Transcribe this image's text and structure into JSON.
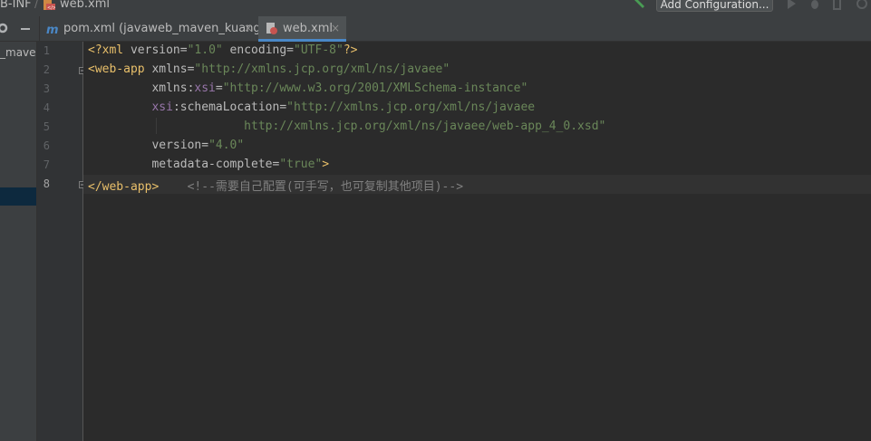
{
  "breadcrumb": {
    "parent": "B-INF",
    "separator": "/",
    "file": "web.xml"
  },
  "toolbar": {
    "run_config_label": "Add Configuration..."
  },
  "tabs": [
    {
      "label": "pom.xml (javaweb_maven_kuang)",
      "close": "×",
      "icon": "maven-m-icon",
      "active": false
    },
    {
      "label": "web.xml",
      "close": "×",
      "icon": "xml-file-icon",
      "active": true
    }
  ],
  "project_panel": {
    "item_label": "_maven"
  },
  "editor": {
    "line_numbers": [
      "1",
      "2",
      "3",
      "4",
      "5",
      "6",
      "7",
      "8"
    ],
    "current_line": "8",
    "lines": [
      {
        "parts": [
          [
            "tag",
            "<?xml "
          ],
          [
            "attr",
            "version="
          ],
          [
            "str",
            "\"1.0\""
          ],
          [
            "attr",
            " encoding="
          ],
          [
            "str",
            "\"UTF-8\""
          ],
          [
            "tag",
            "?>"
          ]
        ]
      },
      {
        "parts": [
          [
            "tag",
            "<web-app "
          ],
          [
            "attr",
            "xmlns="
          ],
          [
            "str",
            "\"http://xmlns.jcp.org/xml/ns/javaee\""
          ]
        ]
      },
      {
        "parts": [
          [
            "attr",
            "         xmlns:"
          ],
          [
            "ns",
            "xsi"
          ],
          [
            "attr",
            "="
          ],
          [
            "str",
            "\"http://www.w3.org/2001/XMLSchema-instance\""
          ]
        ]
      },
      {
        "parts": [
          [
            "attr",
            "         "
          ],
          [
            "ns",
            "xsi"
          ],
          [
            "attr",
            ":schemaLocation="
          ],
          [
            "str",
            "\"http://xmlns.jcp.org/xml/ns/javaee"
          ]
        ]
      },
      {
        "parts": [
          [
            "str",
            "                      http://xmlns.jcp.org/xml/ns/javaee/web-app_4_0.xsd\""
          ]
        ]
      },
      {
        "parts": [
          [
            "attr",
            "         version="
          ],
          [
            "str",
            "\"4.0\""
          ]
        ]
      },
      {
        "parts": [
          [
            "attr",
            "         metadata-complete="
          ],
          [
            "str",
            "\"true\""
          ],
          [
            "tag",
            ">"
          ]
        ]
      },
      {
        "parts": [
          [
            "tag",
            "</web-app>"
          ],
          [
            "cmt",
            "    <!--需要自己配置(可手写，也可复制其他项目)-->"
          ]
        ]
      }
    ]
  },
  "colors": {
    "accent": "#4a88c7",
    "tag": "#e8bf6a",
    "string": "#6a8759",
    "namespace": "#9876aa",
    "comment": "#808080"
  }
}
